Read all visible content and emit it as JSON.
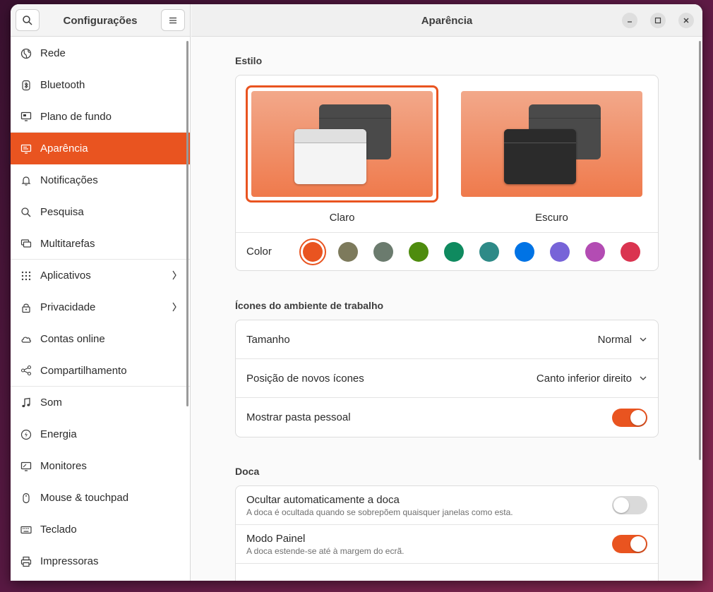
{
  "sidebar": {
    "title": "Configurações",
    "items": [
      {
        "label": "Rede",
        "icon": "globe-icon"
      },
      {
        "label": "Bluetooth",
        "icon": "bluetooth-icon"
      },
      {
        "label": "Plano de fundo",
        "icon": "monitor-icon"
      },
      {
        "label": "Aparência",
        "icon": "appearance-icon"
      },
      {
        "label": "Notificações",
        "icon": "bell-icon"
      },
      {
        "label": "Pesquisa",
        "icon": "search-icon"
      },
      {
        "label": "Multitarefas",
        "icon": "multitask-icon"
      },
      {
        "label": "Aplicativos",
        "icon": "apps-grid-icon"
      },
      {
        "label": "Privacidade",
        "icon": "lock-icon"
      },
      {
        "label": "Contas online",
        "icon": "cloud-icon"
      },
      {
        "label": "Compartilhamento",
        "icon": "share-icon"
      },
      {
        "label": "Som",
        "icon": "music-note-icon"
      },
      {
        "label": "Energia",
        "icon": "power-icon"
      },
      {
        "label": "Monitores",
        "icon": "display-icon"
      },
      {
        "label": "Mouse & touchpad",
        "icon": "mouse-icon"
      },
      {
        "label": "Teclado",
        "icon": "keyboard-icon"
      },
      {
        "label": "Impressoras",
        "icon": "printer-icon"
      }
    ]
  },
  "header": {
    "title": "Aparência"
  },
  "style": {
    "section_title": "Estilo",
    "themes": [
      {
        "label": "Claro",
        "selected": true
      },
      {
        "label": "Escuro",
        "selected": false
      }
    ],
    "color_label": "Color",
    "accent_colors": [
      "#e95420",
      "#7d7a5c",
      "#6b7b6e",
      "#4e8c0e",
      "#0f8a5f",
      "#2e8a87",
      "#0073e5",
      "#7764d8",
      "#b34cb3",
      "#da3450"
    ],
    "selected_color": "#e95420"
  },
  "desktop_icons": {
    "section_title": "Ícones do ambiente de trabalho",
    "size_label": "Tamanho",
    "size_value": "Normal",
    "position_label": "Posição de novos ícones",
    "position_value": "Canto inferior direito",
    "home_label": "Mostrar pasta pessoal",
    "home_on": true
  },
  "dock": {
    "section_title": "Doca",
    "autohide_label": "Ocultar automaticamente a doca",
    "autohide_sub": "A doca é ocultada quando se sobrepõem quaisquer janelas como esta.",
    "autohide_on": false,
    "panel_label": "Modo Painel",
    "panel_sub": "A doca estende-se até à margem do ecrã.",
    "panel_on": true
  }
}
